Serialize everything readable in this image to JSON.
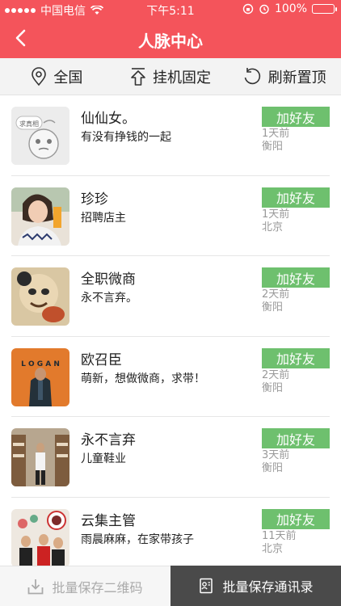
{
  "status_bar": {
    "carrier": "中国电信",
    "time": "下午5:11",
    "battery": "100%"
  },
  "nav": {
    "title": "人脉中心",
    "back_icon": "chevron-left-icon"
  },
  "toolbar": [
    {
      "label": "全国",
      "icon": "location-pin-icon"
    },
    {
      "label": "挂机固定",
      "icon": "pin-top-icon"
    },
    {
      "label": "刷新置顶",
      "icon": "refresh-icon"
    }
  ],
  "contacts": [
    {
      "name": "仙仙女。",
      "desc": "有没有挣钱的一起",
      "button": "加好友",
      "time": "1天前",
      "place": "衡阳",
      "avatar_caption": "求真相"
    },
    {
      "name": "珍珍",
      "desc": "招聘店主",
      "button": "加好友",
      "time": "1天前",
      "place": "北京"
    },
    {
      "name": "全职微商",
      "desc": "永不言弃。",
      "button": "加好友",
      "time": "2天前",
      "place": "衡阳"
    },
    {
      "name": "欧召臣",
      "desc": "萌新，想做微商，求带！",
      "button": "加好友",
      "time": "2天前",
      "place": "衡阳",
      "avatar_caption": "L O G A N"
    },
    {
      "name": "永不言弃",
      "desc": "儿童鞋业",
      "button": "加好友",
      "time": "3天前",
      "place": "衡阳"
    },
    {
      "name": "云集主管",
      "desc": "雨晨麻麻，在家带孩子",
      "button": "加好友",
      "time": "11天前",
      "place": "北京"
    }
  ],
  "bottom": {
    "save_qr": "批量保存二维码",
    "save_contacts": "批量保存通讯录"
  },
  "colors": {
    "header": "#f4545b",
    "add_button": "#6ec06e",
    "bottom_dark": "#4a4a4a"
  }
}
